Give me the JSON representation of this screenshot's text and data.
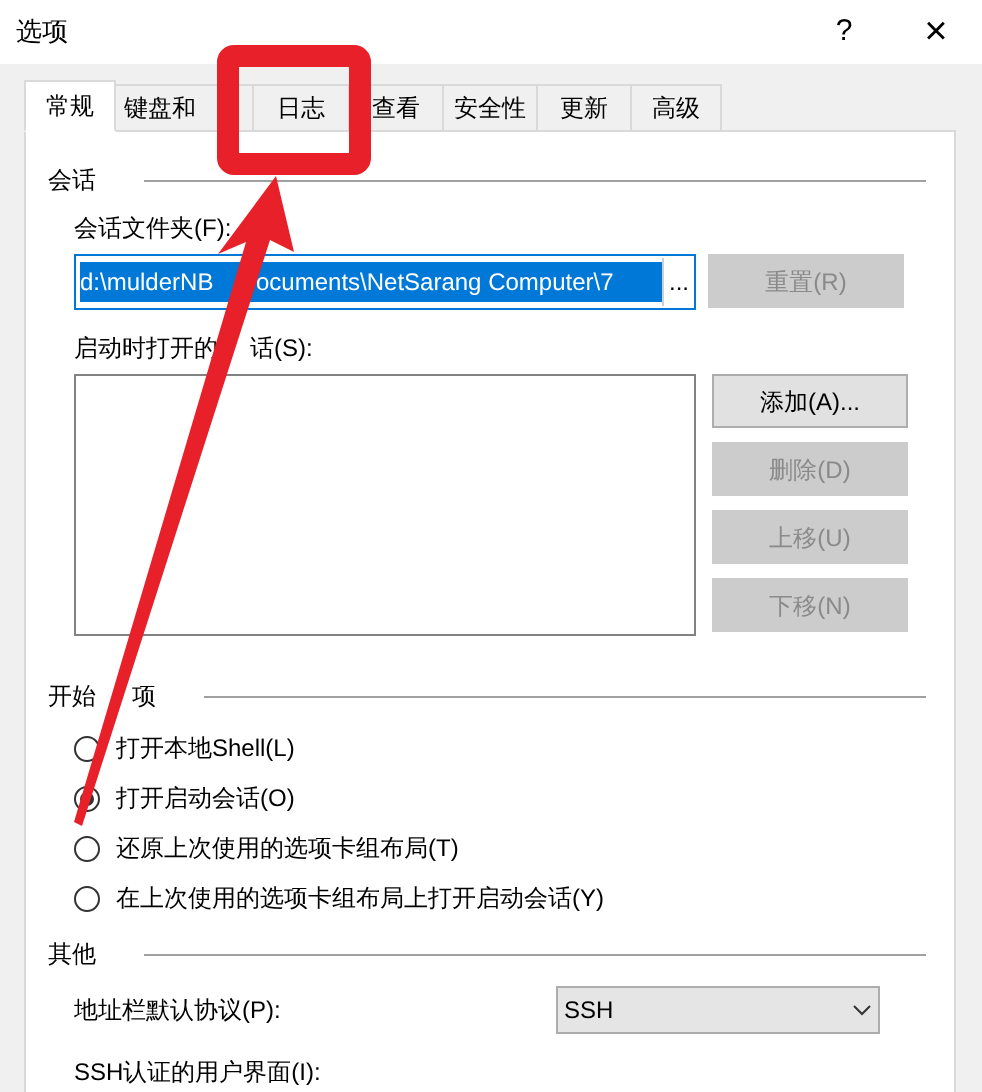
{
  "window": {
    "title": "选项",
    "help": "?",
    "close": "×"
  },
  "tabs": [
    {
      "label": "常规",
      "selected": true
    },
    {
      "label": "键盘和",
      "selected": false
    },
    {
      "label": "日志",
      "selected": false
    },
    {
      "label": "查看",
      "selected": false
    },
    {
      "label": "安全性",
      "selected": false
    },
    {
      "label": "更新",
      "selected": false
    },
    {
      "label": "高级",
      "selected": false
    }
  ],
  "session": {
    "heading": "会话",
    "folder_label": "会话文件夹(F):",
    "folder_value_parts": [
      "d:\\mulderNB",
      "ocuments\\NetSarang Computer\\7"
    ],
    "browse": "...",
    "reset": {
      "label": "重置(R)",
      "disabled": true
    },
    "startup_label_parts": [
      "启动时打开的",
      "话(S):"
    ],
    "buttons": [
      {
        "label": "添加(A)...",
        "disabled": false
      },
      {
        "label": "删除(D)",
        "disabled": true
      },
      {
        "label": "上移(U)",
        "disabled": true
      },
      {
        "label": "下移(N)",
        "disabled": true
      }
    ]
  },
  "start_options": {
    "heading_parts": [
      "开始",
      "项"
    ],
    "options": [
      {
        "label": "打开本地Shell(L)",
        "selected": false
      },
      {
        "label": "打开启动会话(O)",
        "selected": true
      },
      {
        "label": "还原上次使用的选项卡组布局(T)",
        "selected": false
      },
      {
        "label": "在上次使用的选项卡组布局上打开启动会话(Y)",
        "selected": false
      }
    ]
  },
  "other": {
    "heading": "其他",
    "protocol_label": "地址栏默认协议(P):",
    "protocol_value": "SSH",
    "ssh_ui_label": "SSH认证的用户界面(I):"
  }
}
